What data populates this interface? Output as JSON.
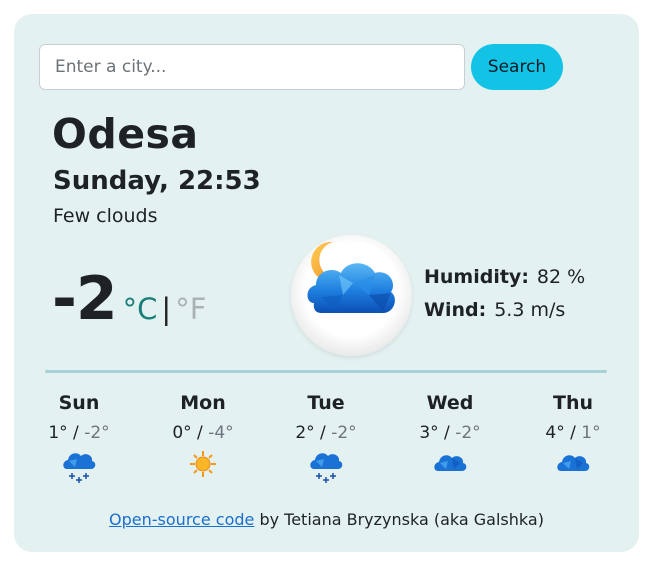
{
  "search": {
    "placeholder": "Enter a city...",
    "value": "",
    "button_label": "Search"
  },
  "current": {
    "city": "Odesa",
    "datetime": "Sunday, 22:53",
    "description": "Few clouds",
    "temperature": "-2",
    "unit_celsius": "°C",
    "unit_separator": "|",
    "unit_fahrenheit": "°F",
    "active_unit": "celsius",
    "icon": "few-clouds-night-icon",
    "humidity_label": "Humidity:",
    "humidity_value": "82 %",
    "wind_label": "Wind:",
    "wind_value": "5.3 m/s"
  },
  "forecast": [
    {
      "day": "Sun",
      "max": "1°",
      "separator": " / ",
      "min": "-2°",
      "icon": "snow-cloud-icon"
    },
    {
      "day": "Mon",
      "max": "0°",
      "separator": " / ",
      "min": "-4°",
      "icon": "sun-icon"
    },
    {
      "day": "Tue",
      "max": "2°",
      "separator": " / ",
      "min": "-2°",
      "icon": "snow-cloud-icon"
    },
    {
      "day": "Wed",
      "max": "3°",
      "separator": " / ",
      "min": "-2°",
      "icon": "cloud-icon"
    },
    {
      "day": "Thu",
      "max": "4°",
      "separator": " / ",
      "min": "1°",
      "icon": "cloud-icon"
    }
  ],
  "footer": {
    "link_text": "Open-source code",
    "text": " by Tetiana Bryzynska (aka Galshka)"
  },
  "colors": {
    "card_bg": "#e3f1f1",
    "button": "#12c3e6",
    "celsius_active": "#1a7f7a",
    "fahrenheit_inactive": "#aab2b8",
    "link": "#1a6fd0"
  }
}
